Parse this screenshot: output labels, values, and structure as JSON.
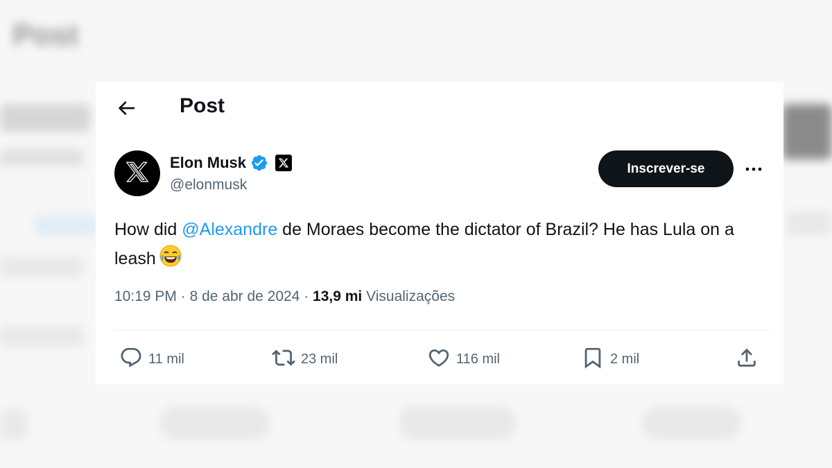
{
  "background": {
    "blurred_title": "Post"
  },
  "header": {
    "title": "Post"
  },
  "author": {
    "display_name": "Elon Musk",
    "handle": "@elonmusk"
  },
  "subscribe_label": "Inscrever-se",
  "tweet": {
    "prefix": "How did ",
    "mention": "@Alexandre",
    "rest": " de Moraes become the dictator of Brazil? He has Lula on a leash"
  },
  "meta": {
    "time": "10:19 PM",
    "separator1": " · ",
    "date": "8 de abr de 2024",
    "separator2": " · ",
    "views_count": "13,9 mi",
    "views_label": " Visualizações"
  },
  "actions": {
    "replies": "11 mil",
    "reposts": "23 mil",
    "likes": "116 mil",
    "bookmarks": "2 mil"
  },
  "colors": {
    "mention": "#1d9bf0",
    "verified": "#1d9bf0",
    "button_bg": "#0f1419",
    "muted_text": "#536471"
  },
  "icons": [
    "back-arrow-icon",
    "x-logo-icon",
    "verified-badge-icon",
    "x-affiliate-icon",
    "more-icon",
    "laughing-emoji-icon",
    "reply-icon",
    "repost-icon",
    "like-icon",
    "bookmark-icon",
    "share-icon"
  ]
}
